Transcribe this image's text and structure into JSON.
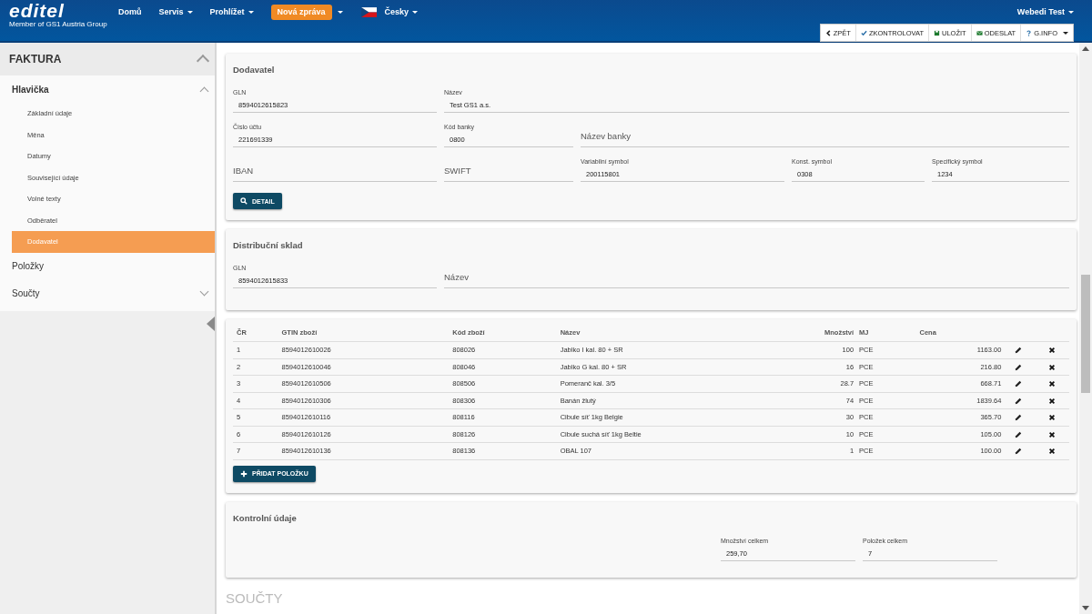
{
  "header": {
    "logo": "editel",
    "tagline": "Member of GS1 Austria Group",
    "nav": [
      {
        "label": "Domů",
        "dropdown": false
      },
      {
        "label": "Servis",
        "dropdown": true
      },
      {
        "label": "Prohlížet",
        "dropdown": true
      }
    ],
    "new_message": "Nová zpráva",
    "language": "Česky",
    "user": "Webedi Test"
  },
  "toolbar": [
    {
      "kind": "back",
      "label": "ZPĚT",
      "dropdown": false
    },
    {
      "kind": "check",
      "label": "ZKONTROLOVAT",
      "dropdown": false
    },
    {
      "kind": "save",
      "label": "ULOŽIT",
      "dropdown": false
    },
    {
      "kind": "send",
      "label": "ODESLAT",
      "dropdown": false
    },
    {
      "kind": "help",
      "label": "G.INFO",
      "dropdown": true
    }
  ],
  "sidebar": {
    "title": "FAKTURA",
    "expanded": true,
    "sections": [
      {
        "label": "Hlavička",
        "expanded": true,
        "children": [
          {
            "label": "Základní údaje",
            "selected": false
          },
          {
            "label": "Měna",
            "selected": false
          },
          {
            "label": "Datumy",
            "selected": false
          },
          {
            "label": "Související údaje",
            "selected": false
          },
          {
            "label": "Volné texty",
            "selected": false
          },
          {
            "label": "Odběratel",
            "selected": false
          },
          {
            "label": "Dodavatel",
            "selected": true
          }
        ]
      },
      {
        "label": "Položky"
      },
      {
        "label": "Součty",
        "expanded": false
      }
    ]
  },
  "supplier": {
    "title": "Dodavatel",
    "rows": [
      [
        {
          "label": "GLN",
          "value": "8594012615823"
        },
        {
          "label": "Název",
          "value": "Test GS1 a.s."
        }
      ],
      [
        {
          "label": "Číslo účtu",
          "value": "221691339"
        },
        {
          "label": "Kód banky",
          "value": "0800"
        },
        {
          "placeholder": "Název banky"
        }
      ],
      [
        {
          "placeholder": "IBAN"
        },
        {
          "placeholder": "SWIFT"
        },
        {
          "label": "Variabilní symbol",
          "value": "200115801"
        },
        {
          "label": "Konst. symbol",
          "value": "0308"
        },
        {
          "label": "Specifický symbol",
          "value": "1234"
        }
      ]
    ],
    "button": "DETAIL"
  },
  "warehouse": {
    "title": "Distribuční sklad",
    "rows": [
      [
        {
          "label": "GLN",
          "value": "8594012615833"
        },
        {
          "placeholder": "Název"
        }
      ]
    ]
  },
  "items": {
    "columns": [
      "ČR",
      "GTIN zboží",
      "Kód zboží",
      "Název",
      "Množství",
      "MJ",
      "Cena"
    ],
    "rows": [
      [
        "1",
        "8594012610026",
        "808026",
        "Jablko I kal. 80 + SR",
        "100",
        "PCE",
        "1163.00"
      ],
      [
        "2",
        "8594012610046",
        "808046",
        "Jablko G kal. 80 + SR",
        "16",
        "PCE",
        "216.80"
      ],
      [
        "3",
        "8594012610506",
        "808506",
        "Pomeranč kal. 3/5",
        "28.7",
        "PCE",
        "668.71"
      ],
      [
        "4",
        "8594012610306",
        "808306",
        "Banán žlutý",
        "74",
        "PCE",
        "1839.64"
      ],
      [
        "5",
        "8594012610116",
        "808116",
        "Cibule síť 1kg Belgie",
        "30",
        "PCE",
        "365.70"
      ],
      [
        "6",
        "8594012610126",
        "808126",
        "Cibule suchá síť 1kg Beltie",
        "10",
        "PCE",
        "105.00"
      ],
      [
        "7",
        "8594012610136",
        "808136",
        "OBAL 107",
        "1",
        "PCE",
        "100.00"
      ]
    ],
    "button": "PŘIDAT POLOŽKU"
  },
  "control": {
    "title": "Kontrolní údaje",
    "fields": [
      {
        "label": "Množství celkem",
        "value": "259,70"
      },
      {
        "label": "Položek celkem",
        "value": "7"
      }
    ]
  },
  "totals_heading": "SOUČTY"
}
